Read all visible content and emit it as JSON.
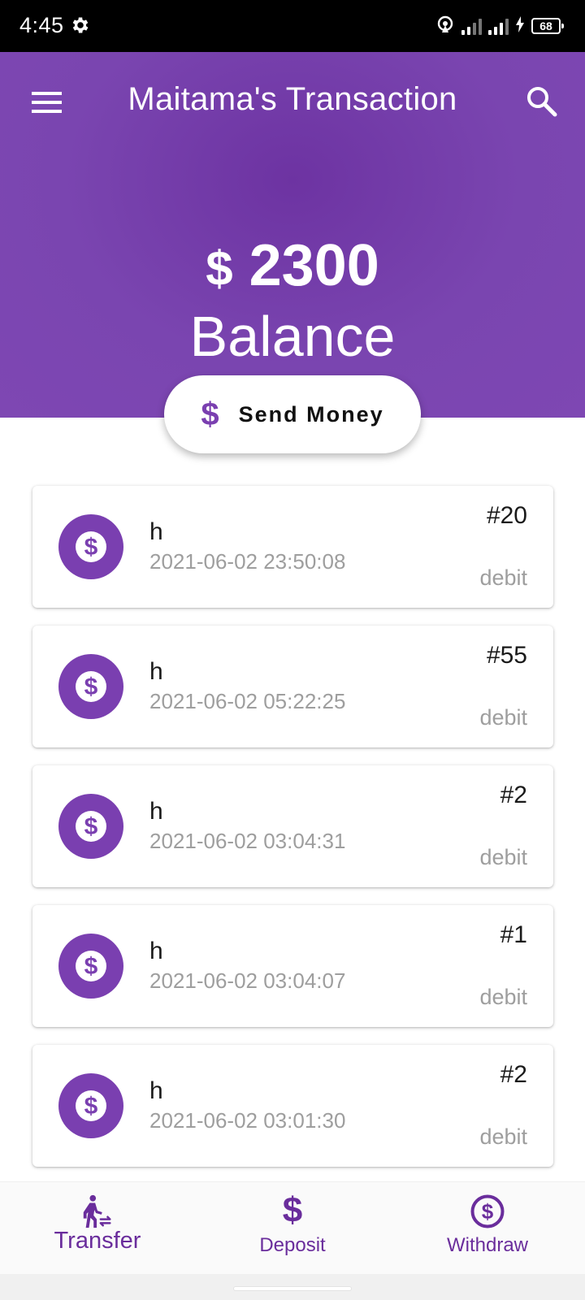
{
  "status_bar": {
    "time": "4:45",
    "battery": "68",
    "icons": [
      "gear-icon",
      "hotspot-icon",
      "signal-icon",
      "signal-icon",
      "charging-icon",
      "battery-icon"
    ]
  },
  "header": {
    "title": "Maitama's Transaction",
    "balance_currency": "$",
    "balance_amount": "2300",
    "balance_label": "Balance",
    "accent_color": "#7a3fb0"
  },
  "send_money": {
    "icon": "dollar-icon",
    "label": "Send Money"
  },
  "transactions": [
    {
      "name": "h",
      "date": "2021-06-02 23:50:08",
      "id": "#20",
      "type": "debit"
    },
    {
      "name": "h",
      "date": "2021-06-02 05:22:25",
      "id": "#55",
      "type": "debit"
    },
    {
      "name": "h",
      "date": "2021-06-02 03:04:31",
      "id": "#2",
      "type": "debit"
    },
    {
      "name": "h",
      "date": "2021-06-02 03:04:07",
      "id": "#1",
      "type": "debit"
    },
    {
      "name": "h",
      "date": "2021-06-02 03:01:30",
      "id": "#2",
      "type": "debit"
    }
  ],
  "bottom_nav": [
    {
      "label": "Transfer",
      "icon": "transfer-icon",
      "active": true
    },
    {
      "label": "Deposit",
      "icon": "dollar-icon",
      "active": false
    },
    {
      "label": "Withdraw",
      "icon": "dollar-circle-icon",
      "active": false
    }
  ]
}
